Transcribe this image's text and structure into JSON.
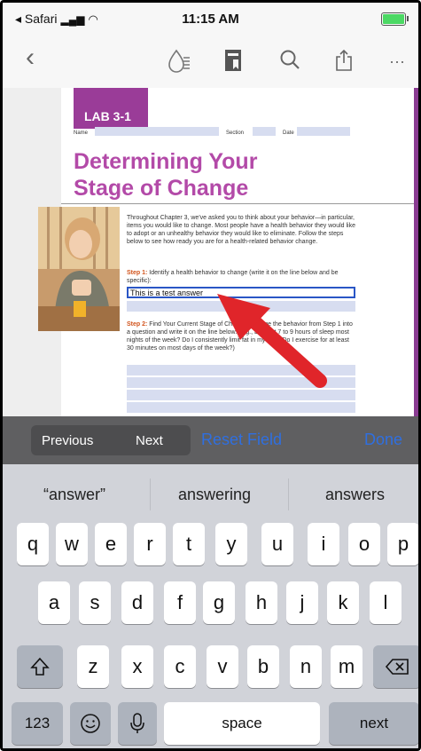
{
  "status_bar": {
    "carrier": "◂ Safari",
    "time": "11:15 AM"
  },
  "toolbar": {
    "back_icon": "chevron-left-icon",
    "icons": [
      "reader-icon",
      "bookmark-icon",
      "search-icon",
      "share-icon",
      "more-icon"
    ]
  },
  "document": {
    "lab_label": "LAB 3-1",
    "name_label": "Name",
    "section_label": "Section",
    "date_label": "Date",
    "title_line1": "Determining Your",
    "title_line2": "Stage of Change",
    "intro": "Throughout Chapter 3, we've asked you to think about your behavior—in particular, items you would like to change. Most people have a health behavior they would like to adopt or an unhealthy behavior they would like to eliminate. Follow the steps below to see how ready you are for a health-related behavior change.",
    "step1_label": "Step 1:",
    "step1_text": "Identify a health behavior to change (write it on the line below and be specific):",
    "answer_value": "This is a test answer",
    "step2_label": "Step 2:",
    "step2_text": "Find Your Current Stage of Change. Change the behavior from Step 1 into a question and write it on the line below. (e.g., Do I get 7 to 9 hours of sleep most nights of the week? Do I consistently limit fat in my diet? Do I exercise for at least 30 minutes on most days of the week?)"
  },
  "accessory": {
    "previous": "Previous",
    "next": "Next",
    "reset": "Reset Field",
    "done": "Done"
  },
  "keyboard": {
    "suggestions": [
      "“answer”",
      "answering",
      "answers"
    ],
    "row1": [
      "q",
      "w",
      "e",
      "r",
      "t",
      "y",
      "u",
      "i",
      "o",
      "p"
    ],
    "row2": [
      "a",
      "s",
      "d",
      "f",
      "g",
      "h",
      "j",
      "k",
      "l"
    ],
    "row3": [
      "z",
      "x",
      "c",
      "v",
      "b",
      "n",
      "m"
    ],
    "numbers": "123",
    "space": "space",
    "return": "next"
  },
  "colors": {
    "accent": "#2f6fe0",
    "purple": "#9a3c98",
    "arrow": "#e0252a"
  }
}
